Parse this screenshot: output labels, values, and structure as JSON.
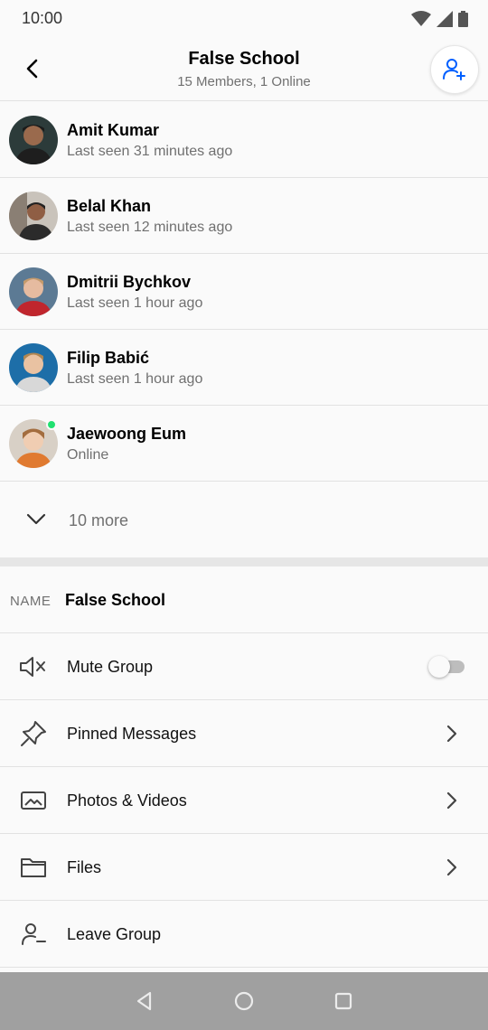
{
  "status_bar": {
    "time": "10:00",
    "icons": [
      "wifi-icon",
      "cell-signal-icon",
      "battery-icon"
    ]
  },
  "header": {
    "title": "False School",
    "subtitle": "15 Members, 1 Online",
    "back_icon": "chevron-left-icon",
    "add_icon": "add-user-icon",
    "accent_color": "#005fff"
  },
  "members": [
    {
      "name": "Amit Kumar",
      "status": "Last seen 31 minutes ago",
      "online": false
    },
    {
      "name": "Belal Khan",
      "status": "Last seen 12 minutes ago",
      "online": false
    },
    {
      "name": "Dmitrii Bychkov",
      "status": "Last seen 1 hour ago",
      "online": false
    },
    {
      "name": "Filip Babić",
      "status": "Last seen 1 hour ago",
      "online": false
    },
    {
      "name": "Jaewoong Eum",
      "status": "Online",
      "online": true
    }
  ],
  "more": {
    "label": "10 more",
    "icon": "chevron-down-icon"
  },
  "group_name": {
    "label": "NAME",
    "value": "False School"
  },
  "options": [
    {
      "label": "Mute Group",
      "icon": "mute-icon",
      "control": "toggle",
      "toggle_on": false
    },
    {
      "label": "Pinned Messages",
      "icon": "pin-icon",
      "control": "chevron"
    },
    {
      "label": "Photos & Videos",
      "icon": "image-icon",
      "control": "chevron"
    },
    {
      "label": "Files",
      "icon": "folder-icon",
      "control": "chevron"
    },
    {
      "label": "Leave Group",
      "icon": "leave-group-icon",
      "control": "none"
    }
  ],
  "nav_bar": [
    "back-triangle-icon",
    "home-circle-icon",
    "recents-square-icon"
  ],
  "colors": {
    "online": "#20e070",
    "secondary_text": "#707070",
    "divider": "#e2e2e2",
    "nav_bar": "#a0a0a0"
  }
}
